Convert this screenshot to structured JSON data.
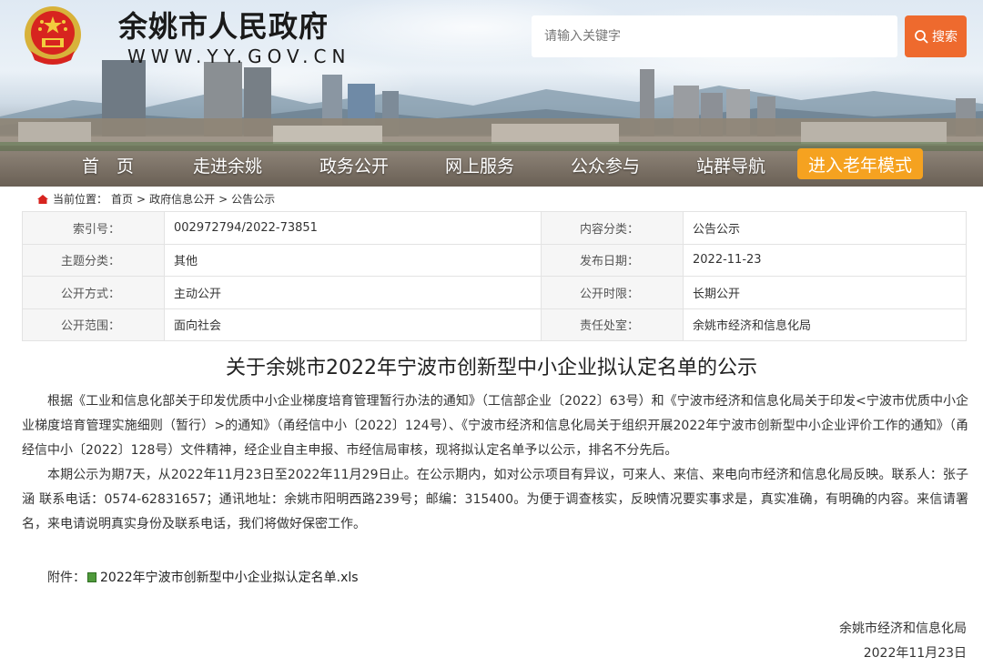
{
  "header": {
    "site_title": "余姚市人民政府",
    "site_domain": "WWW.YY.GOV.CN",
    "search_placeholder": "请输入关键字",
    "search_button": "搜索"
  },
  "nav": {
    "items": [
      "首　页",
      "走进余姚",
      "政务公开",
      "网上服务",
      "公众参与",
      "站群导航"
    ],
    "elder_mode": "进入老年模式"
  },
  "breadcrumb": {
    "prefix": "当前位置：",
    "items": [
      "首页",
      "政府信息公开",
      "公告公示"
    ],
    "sep": ">"
  },
  "meta": {
    "rows": [
      {
        "l1": "索引号：",
        "v1": "002972794/2022-73851",
        "l2": "内容分类：",
        "v2": "公告公示"
      },
      {
        "l1": "主题分类：",
        "v1": "其他",
        "l2": "发布日期：",
        "v2": "2022-11-23"
      },
      {
        "l1": "公开方式：",
        "v1": "主动公开",
        "l2": "公开时限：",
        "v2": "长期公开"
      },
      {
        "l1": "公开范围：",
        "v1": "面向社会",
        "l2": "责任处室：",
        "v2": "余姚市经济和信息化局"
      }
    ]
  },
  "article": {
    "title": "关于余姚市2022年宁波市创新型中小企业拟认定名单的公示",
    "paragraphs": [
      "根据《工业和信息化部关于印发优质中小企业梯度培育管理暂行办法的通知》（工信部企业〔2022〕63号）和《宁波市经济和信息化局关于印发<宁波市优质中小企业梯度培育管理实施细则（暂行）>的通知》（甬经信中小〔2022〕124号）、《宁波市经济和信息化局关于组织开展2022年宁波市创新型中小企业评价工作的通知》（甬经信中小〔2022〕128号）文件精神，经企业自主申报、市经信局审核，现将拟认定名单予以公示，排名不分先后。",
      "本期公示为期7天，从2022年11月23日至2022年11月29日止。在公示期内，如对公示项目有异议，可来人、来信、来电向市经济和信息化局反映。联系人：张子涵 联系电话：0574-62831657；通讯地址：余姚市阳明西路239号；邮编：315400。为便于调查核实，反映情况要实事求是，真实准确，有明确的内容。来信请署名，来电请说明真实身份及联系电话，我们将做好保密工作。"
    ],
    "attachment_label": "附件：",
    "attachment_file": "2022年宁波市创新型中小企业拟认定名单.xls",
    "sign_org": "余姚市经济和信息化局",
    "sign_date": "2022年11月23日"
  }
}
